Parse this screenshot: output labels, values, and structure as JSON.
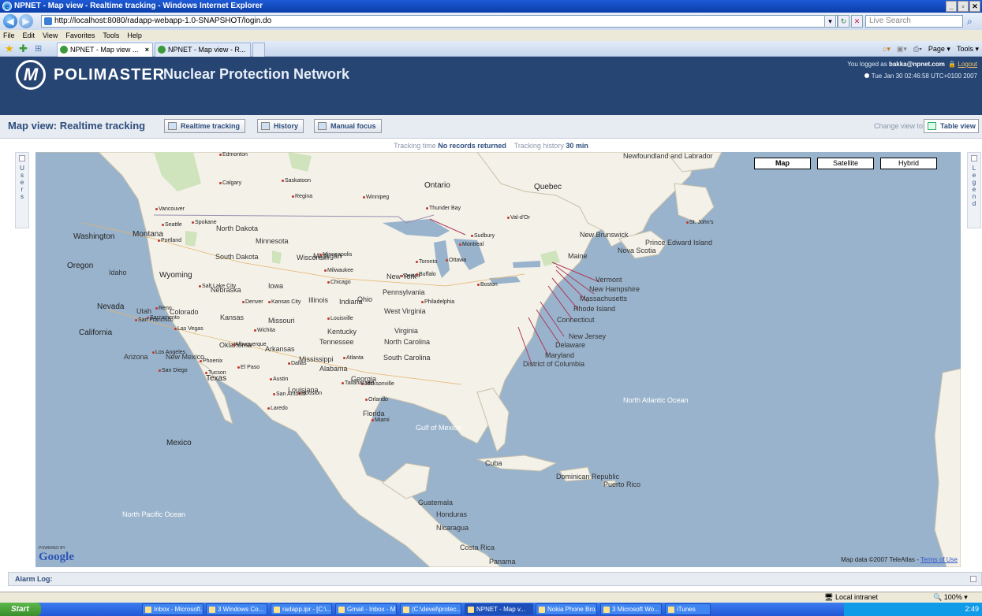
{
  "browser": {
    "title": "NPNET - Map view - Realtime tracking - Windows Internet Explorer",
    "url": "http://localhost:8080/radapp-webapp-1.0-SNAPSHOT/login.do",
    "search_placeholder": "Live Search",
    "menu": [
      "File",
      "Edit",
      "View",
      "Favorites",
      "Tools",
      "Help"
    ],
    "tabs": [
      "NPNET - Map view ...",
      "NPNET - Map view - R..."
    ],
    "commands": [
      "Page",
      "Tools"
    ],
    "status_zone": "Local intranet",
    "zoom": "100%"
  },
  "header": {
    "brand": "POLIMASTER",
    "product": "Nuclear Protection Network",
    "logged_prefix": "You logged as",
    "user": "bakka@npnet.com",
    "logout": "Logout",
    "datetime": "Tue Jan 30 02:46:58 UTC+0100 2007"
  },
  "toolbar": {
    "title": "Map view: Realtime tracking",
    "buttons": [
      "Realtime tracking",
      "History",
      "Manual focus"
    ],
    "change_view_label": "Change view to:",
    "table_view": "Table view"
  },
  "tracking": {
    "time_label": "Tracking time",
    "time_value": "No records returned",
    "history_label": "Tracking history",
    "history_value": "30 min"
  },
  "panels": {
    "left": "Users",
    "right": "Legend"
  },
  "map": {
    "types": [
      "Map",
      "Satellite",
      "Hybrid"
    ],
    "selected": "Map",
    "google": "Google",
    "powered": "POWERED BY",
    "copyright": "Map data ©2007 TeleAtlas -",
    "terms": "Terms of Use",
    "regions": [
      "Ontario",
      "Quebec",
      "Washington",
      "Montana",
      "North Dakota",
      "Minnesota",
      "Oregon",
      "Idaho",
      "Wyoming",
      "South Dakota",
      "Wisconsin",
      "Michigan",
      "New York",
      "Nebraska",
      "Iowa",
      "Nevada",
      "Utah",
      "Colorado",
      "Kansas",
      "Illinois",
      "Indiana",
      "Ohio",
      "Pennsylvania",
      "California",
      "Missouri",
      "West Virginia",
      "Virginia",
      "Kentucky",
      "Arizona",
      "New Mexico",
      "Oklahoma",
      "Tennessee",
      "North Carolina",
      "Arkansas",
      "Mississippi",
      "Alabama",
      "Georgia",
      "South Carolina",
      "Texas",
      "Louisiana",
      "Florida",
      "Mexico",
      "Cuba",
      "Maine",
      "Vermont",
      "New Hampshire",
      "Massachusetts",
      "Rhode Island",
      "Connecticut",
      "New Jersey",
      "Delaware",
      "Maryland",
      "District of Columbia",
      "New Brunswick",
      "Nova Scotia",
      "Prince Edward Island",
      "Newfoundland and Labrador",
      "Honduras",
      "Nicaragua",
      "Guatemala",
      "Costa Rica",
      "Panama",
      "Dominican Republic",
      "Puerto Rico"
    ],
    "oceans": [
      "North Pacific Ocean",
      "North Atlantic Ocean",
      "Gulf of Mexico"
    ],
    "cities": [
      "Edmonton",
      "Calgary",
      "Saskatoon",
      "Regina",
      "Winnipeg",
      "Vancouver",
      "Seattle",
      "Portland",
      "Spokane",
      "Minneapolis",
      "Milwaukee",
      "Chicago",
      "Detroit",
      "Toronto",
      "Ottawa",
      "Montreal",
      "Buffalo",
      "Boston",
      "Philadelphia",
      "Denver",
      "Salt Lake City",
      "Las Vegas",
      "Los Angeles",
      "San Diego",
      "Phoenix",
      "Tucson",
      "Albuquerque",
      "El Paso",
      "Dallas",
      "Houston",
      "San Antonio",
      "Austin",
      "Atlanta",
      "Jacksonville",
      "Orlando",
      "Miami",
      "Tallahassee",
      "Laredo",
      "Louisville",
      "Sacramento",
      "San Francisco",
      "Reno",
      "Wichita",
      "Kansas City",
      "St. John's",
      "Thunder Bay",
      "Sudbury",
      "Val-d'Or"
    ]
  },
  "alarm": {
    "label": "Alarm Log:"
  },
  "taskbar": {
    "start": "Start",
    "items": [
      "Inbox - Microsoft...",
      "3 Windows Co...",
      "radapp.ipr - [C:\\...",
      "Gmail - Inbox - M...",
      "(C:\\devel\\protec...",
      "NPNET - Map v...",
      "Nokia Phone Bro...",
      "3 Microsoft Wo...",
      "iTunes"
    ],
    "time": "2:49"
  }
}
